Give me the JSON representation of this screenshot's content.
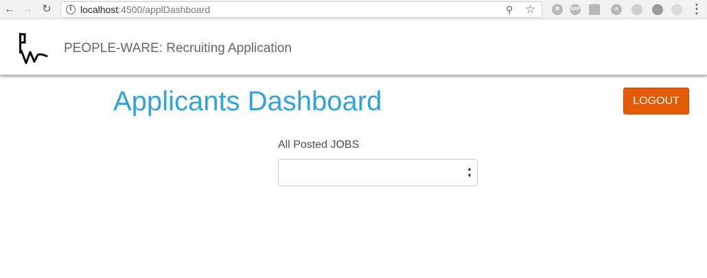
{
  "browser": {
    "url_host": "localhost",
    "url_path": ":4500/applDashboard",
    "back_icon": "arrow-left-icon",
    "forward_icon": "arrow-right-icon",
    "reload_icon": "reload-icon",
    "extensions": [
      "⌘",
      "ABP",
      "",
      "A",
      "",
      "",
      ""
    ]
  },
  "header": {
    "logo": "people-ware-logo",
    "title": "PEOPLE-WARE: Recruiting Application"
  },
  "main": {
    "page_title": "Applicants Dashboard",
    "logout_label": "LOGOUT",
    "jobs_label": "All Posted JOBS",
    "jobs_select_value": ""
  },
  "colors": {
    "accent_title": "#2ea3e0",
    "logout_button": "#e55a06"
  }
}
